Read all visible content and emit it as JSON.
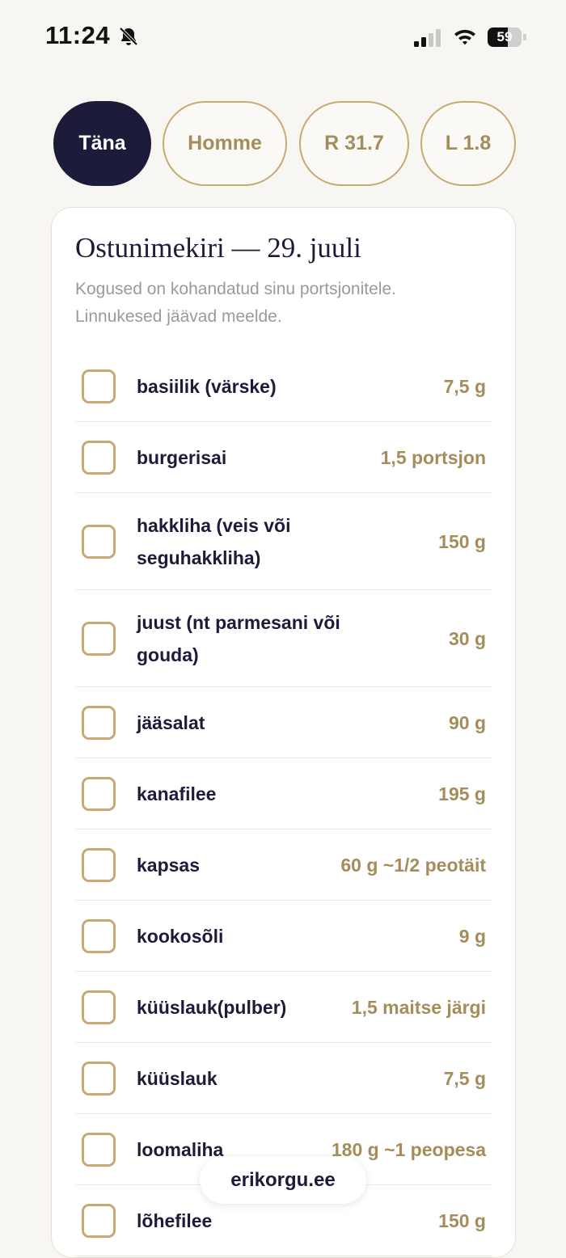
{
  "status_bar": {
    "time": "11:24",
    "battery_level": "59",
    "battery_fill": 0.59,
    "icons": [
      "bell-muted-icon",
      "cellular-signal-icon",
      "wifi-icon",
      "battery-icon"
    ]
  },
  "day_tabs": [
    {
      "label": "Täna",
      "active": true
    },
    {
      "label": "Homme",
      "active": false
    },
    {
      "label": "R 31.7",
      "active": false
    },
    {
      "label": "L 1.8",
      "active": false
    }
  ],
  "card": {
    "title": "Ostunimekiri — 29. juuli",
    "subtitle_line1": "Kogused on kohandatud sinu portsjonitele.",
    "subtitle_line2": "Linnukesed jäävad meelde."
  },
  "items": [
    {
      "name_lines": [
        "basiilik (värske)"
      ],
      "qty": "7,5 g",
      "checked": false
    },
    {
      "name_lines": [
        "burgerisai"
      ],
      "qty": "1,5 portsjon",
      "checked": false
    },
    {
      "name_lines": [
        "hakkliha (veis või",
        "seguhakkliha)"
      ],
      "qty": "150 g",
      "checked": false
    },
    {
      "name_lines": [
        "juust (nt parmesani või",
        "gouda)"
      ],
      "qty": "30 g",
      "checked": false
    },
    {
      "name_lines": [
        "jääsalat"
      ],
      "qty": "90 g",
      "checked": false
    },
    {
      "name_lines": [
        "kanafilee"
      ],
      "qty": "195 g",
      "checked": false
    },
    {
      "name_lines": [
        "kapsas"
      ],
      "qty": "60 g ~1/2 peotäit",
      "checked": false
    },
    {
      "name_lines": [
        "kookosõli"
      ],
      "qty": "9 g",
      "checked": false
    },
    {
      "name_lines": [
        "küüslauk(pulber)"
      ],
      "qty": "1,5 maitse järgi",
      "checked": false
    },
    {
      "name_lines": [
        "küüslauk"
      ],
      "qty": "7,5 g",
      "checked": false
    },
    {
      "name_lines": [
        "loomaliha"
      ],
      "qty": "180 g ~1 peopesa",
      "checked": false
    },
    {
      "name_lines": [
        "lõhefilee"
      ],
      "qty": "150 g",
      "checked": false
    }
  ],
  "footer": {
    "site": "erikorgu.ee"
  },
  "colors": {
    "background": "#f8f6f2",
    "navy": "#1c1c3a",
    "gold": "#c7aa73",
    "gold_text": "#a58d5b",
    "muted_text": "#9a9a9a"
  }
}
